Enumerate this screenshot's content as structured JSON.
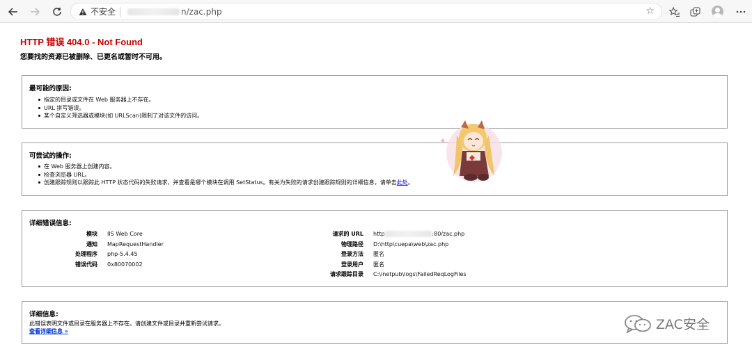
{
  "browser": {
    "security_label": "不安全",
    "url_visible": "n/zac.php"
  },
  "page": {
    "title": "HTTP 错误 404.0 - Not Found",
    "subtitle": "您要找的资源已被删除、已更名或暂时不可用。"
  },
  "causes": {
    "heading": "最可能的原因:",
    "items": [
      "指定的目录或文件在 Web 服务器上不存在。",
      "URL 拼写错误。",
      "某个自定义筛选器或模块(如 URLScan)限制了对该文件的访问。"
    ]
  },
  "actions": {
    "heading": "可尝试的操作:",
    "items": [
      "在 Web 服务器上创建内容。",
      "检查浏览器 URL。"
    ],
    "last_item_text": "创建跟踪规则以跟踪此 HTTP 状态代码的失败请求，并查看是哪个模块在调用 SetStatus。有关为失败的请求创建跟踪规则的详细信息，请单击",
    "last_item_link": "此处",
    "last_item_end": "。"
  },
  "details": {
    "heading": "详细错误信息:",
    "left": [
      {
        "k": "模块",
        "v": "IIS Web Core"
      },
      {
        "k": "通知",
        "v": "MapRequestHandler"
      },
      {
        "k": "处理程序",
        "v": "php-5.4.45"
      },
      {
        "k": "错误代码",
        "v": "0x80070002"
      }
    ],
    "right": [
      {
        "k": "请求的 URL",
        "v_prefix": "http",
        "v_suffix": ":80/zac.php"
      },
      {
        "k": "物理路径",
        "v": "D:\\http\\cuepa\\web\\zac.php"
      },
      {
        "k": "登录方法",
        "v": "匿名"
      },
      {
        "k": "登录用户",
        "v": "匿名"
      },
      {
        "k": "请求跟踪目录",
        "v": "C:\\inetpub\\logs\\FailedReqLogFiles"
      }
    ]
  },
  "more": {
    "heading": "详细信息:",
    "text": "此错误表明文件或目录在服务器上不存在。请创建文件或目录并重新尝试请求。",
    "link": "查看详细信息 »"
  },
  "watermark": {
    "text": "ZAC安全"
  },
  "colors": {
    "title_red": "#cc0000",
    "link_blue": "#0000ee"
  }
}
